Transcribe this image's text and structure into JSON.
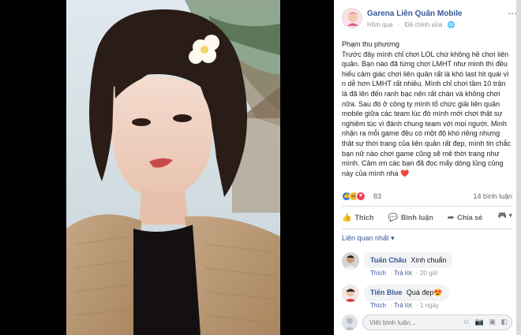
{
  "post": {
    "page_name": "Garena Liên Quân Mobile",
    "time": "Hôm qua",
    "edited": "Đã chỉnh sửa",
    "author_line": "Phạm thu phương",
    "body": "Trước đây mình chỉ chơi LOL chứ không hề chơi liên quân. Bạn nào đã từng chơi LMHT như mình thì đều hiểu cảm giác chơi liên quân rất là khó last hit quái vì n dễ hơn LMHT rất nhiều. Mình chỉ chơi tầm 10 trận là đã lên đến ranh bạc nên rất chán và không chơi nữa. Sau đó ở công ty mình tổ chức giải liên quân mobile giữa các team lúc đó mình mới chơi thật sự nghiêm túc vì đánh chung team với mọi người. Mình nhận ra mỗi game đều có một độ khó riêng nhưng thật sự thời trang của liên quân rất đẹp, mình tin chắc bạn nữ nào chơi game cũng sẽ mê thời trang như mình. Cảm ơn các bạn đã đọc mấy dòng lủng củng này của mình nha ❤️"
  },
  "stats": {
    "reaction_count": "83",
    "comment_count": "14 bình luận"
  },
  "actions": {
    "like": "Thích",
    "comment": "Bình luận",
    "share": "Chia sẻ"
  },
  "filter_label": "Liên quan nhất",
  "comments": [
    {
      "name": "Tuấn Châu",
      "text": "Xinh chuẩn",
      "like": "Thích",
      "reply": "Trả lời",
      "time": "20 giờ"
    },
    {
      "name": "Tiến Blue",
      "text": "Quá đẹp😍",
      "like": "Thích",
      "reply": "Trả lời",
      "time": "1 ngày"
    }
  ],
  "write_comment": {
    "placeholder": "Viết bình luận..."
  },
  "colors": {
    "link": "#385898",
    "like_blue": "#1877f2",
    "love_red": "#f33e58",
    "haha_yellow": "#f7b125"
  },
  "icons": [
    "earth-icon",
    "more-options-icon",
    "like-icon",
    "comment-icon",
    "share-icon",
    "dropdown-icon",
    "emoji-icon",
    "camera-icon",
    "gif-icon",
    "sticker-icon"
  ]
}
